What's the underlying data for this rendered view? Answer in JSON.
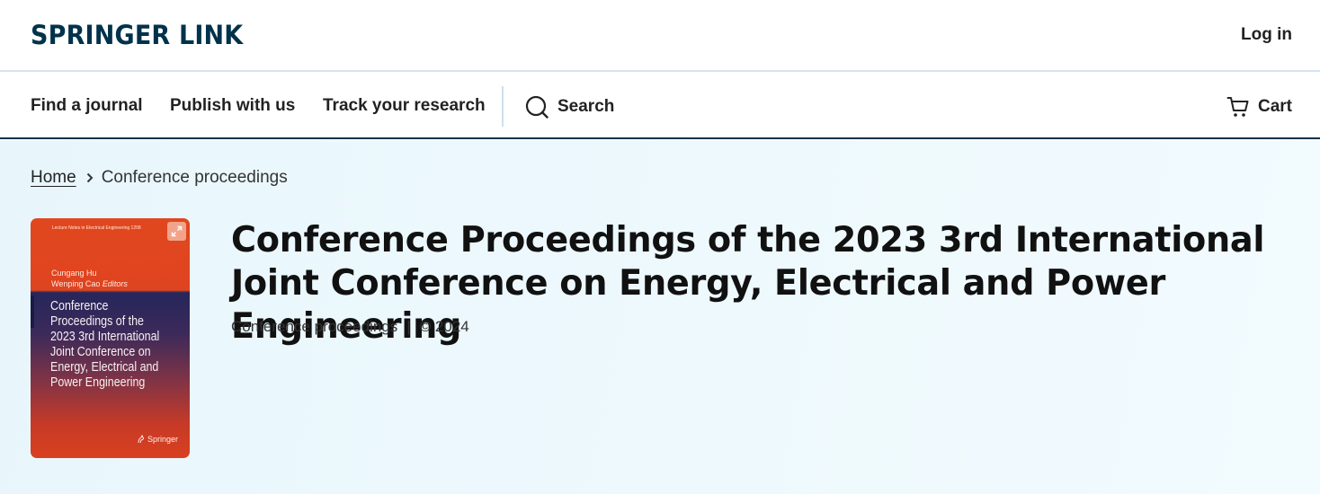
{
  "header": {
    "logo_text": "SPRINGER LINK",
    "login_label": "Log in"
  },
  "nav": {
    "items": [
      "Find a journal",
      "Publish with us",
      "Track your research"
    ],
    "search_label": "Search",
    "cart_label": "Cart"
  },
  "breadcrumb": {
    "home": "Home",
    "current": "Conference proceedings"
  },
  "cover": {
    "series": "Lecture Notes in Electrical Engineering   1208",
    "editor1": "Cungang Hu",
    "editor2": "Wenping Cao",
    "editors_label": "Editors",
    "title": "Conference Proceedings of the 2023 3rd International Joint Conference on Energy, Electrical and Power Engineering",
    "publisher": "Springer",
    "colors": {
      "top": "#e1471e",
      "band": "#26265a"
    }
  },
  "book": {
    "title": "Conference Proceedings of the 2023 3rd International Joint Conference on Energy, Electrical and Power Engineering",
    "type": "Conference proceedings",
    "separator": "|",
    "copyright": "© 2024"
  },
  "colors": {
    "brand": "#01324b",
    "hero_bg": "#eaf7fc"
  },
  "icons": {
    "search": "search-icon",
    "cart": "cart-icon",
    "chevron": "chevron-right-icon",
    "expand": "expand-icon",
    "publisher": "springer-horse-icon"
  }
}
